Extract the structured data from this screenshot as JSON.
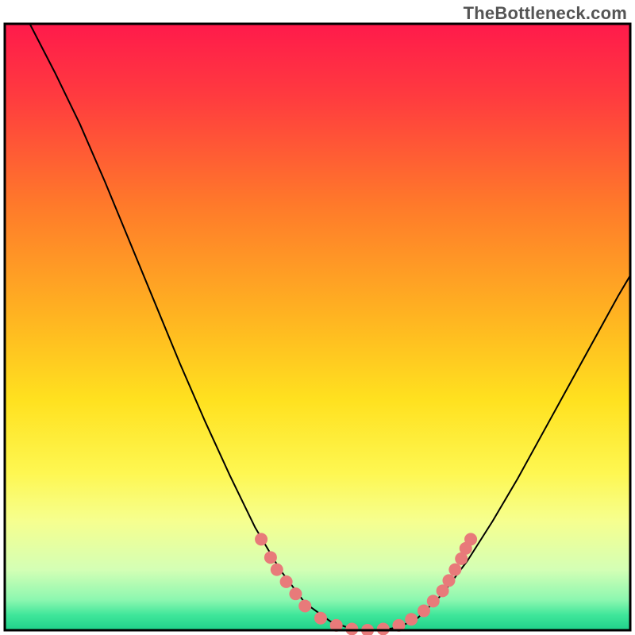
{
  "watermark": "TheBottleneck.com",
  "chart_data": {
    "type": "line",
    "title": "",
    "xlabel": "",
    "ylabel": "",
    "xlim": [
      0,
      100
    ],
    "ylim": [
      0,
      100
    ],
    "background_gradient": {
      "stops": [
        {
          "offset": 0.0,
          "color": "#ff1a4b"
        },
        {
          "offset": 0.12,
          "color": "#ff3b3f"
        },
        {
          "offset": 0.3,
          "color": "#ff7a2a"
        },
        {
          "offset": 0.48,
          "color": "#ffb321"
        },
        {
          "offset": 0.62,
          "color": "#ffe11f"
        },
        {
          "offset": 0.74,
          "color": "#fef751"
        },
        {
          "offset": 0.82,
          "color": "#f6ff8f"
        },
        {
          "offset": 0.9,
          "color": "#d4ffb5"
        },
        {
          "offset": 0.95,
          "color": "#8cf7b0"
        },
        {
          "offset": 0.975,
          "color": "#3fe69a"
        },
        {
          "offset": 1.0,
          "color": "#1fd18a"
        }
      ]
    },
    "series": [
      {
        "name": "curve",
        "stroke": "#000000",
        "stroke_width": 2,
        "points": [
          {
            "x": 4.0,
            "y": 100.0
          },
          {
            "x": 8.0,
            "y": 92.0
          },
          {
            "x": 12.0,
            "y": 83.5
          },
          {
            "x": 16.0,
            "y": 74.0
          },
          {
            "x": 20.0,
            "y": 64.0
          },
          {
            "x": 24.0,
            "y": 54.0
          },
          {
            "x": 28.0,
            "y": 44.0
          },
          {
            "x": 32.0,
            "y": 34.5
          },
          {
            "x": 36.0,
            "y": 25.5
          },
          {
            "x": 40.0,
            "y": 17.0
          },
          {
            "x": 44.0,
            "y": 10.0
          },
          {
            "x": 48.0,
            "y": 4.5
          },
          {
            "x": 52.0,
            "y": 1.5
          },
          {
            "x": 56.0,
            "y": 0.0
          },
          {
            "x": 60.0,
            "y": 0.0
          },
          {
            "x": 63.0,
            "y": 0.5
          },
          {
            "x": 66.0,
            "y": 2.0
          },
          {
            "x": 70.0,
            "y": 6.0
          },
          {
            "x": 74.0,
            "y": 11.5
          },
          {
            "x": 78.0,
            "y": 18.0
          },
          {
            "x": 82.0,
            "y": 25.0
          },
          {
            "x": 86.0,
            "y": 32.5
          },
          {
            "x": 90.0,
            "y": 40.0
          },
          {
            "x": 94.0,
            "y": 47.5
          },
          {
            "x": 98.0,
            "y": 55.0
          },
          {
            "x": 100.0,
            "y": 58.5
          }
        ]
      }
    ],
    "highlight_dots": {
      "fill": "#e87a7a",
      "radius": 8,
      "points": [
        {
          "x": 41.0,
          "y": 15.0
        },
        {
          "x": 42.5,
          "y": 12.0
        },
        {
          "x": 43.5,
          "y": 10.0
        },
        {
          "x": 45.0,
          "y": 8.0
        },
        {
          "x": 46.5,
          "y": 6.0
        },
        {
          "x": 48.0,
          "y": 4.0
        },
        {
          "x": 50.5,
          "y": 2.0
        },
        {
          "x": 53.0,
          "y": 0.8
        },
        {
          "x": 55.5,
          "y": 0.2
        },
        {
          "x": 58.0,
          "y": 0.0
        },
        {
          "x": 60.5,
          "y": 0.2
        },
        {
          "x": 63.0,
          "y": 0.8
        },
        {
          "x": 65.0,
          "y": 1.8
        },
        {
          "x": 67.0,
          "y": 3.2
        },
        {
          "x": 68.5,
          "y": 4.8
        },
        {
          "x": 70.0,
          "y": 6.5
        },
        {
          "x": 71.0,
          "y": 8.2
        },
        {
          "x": 72.0,
          "y": 10.0
        },
        {
          "x": 73.0,
          "y": 11.8
        },
        {
          "x": 73.7,
          "y": 13.5
        },
        {
          "x": 74.5,
          "y": 15.0
        }
      ]
    },
    "frame": {
      "stroke": "#000000",
      "stroke_width": 3
    }
  }
}
